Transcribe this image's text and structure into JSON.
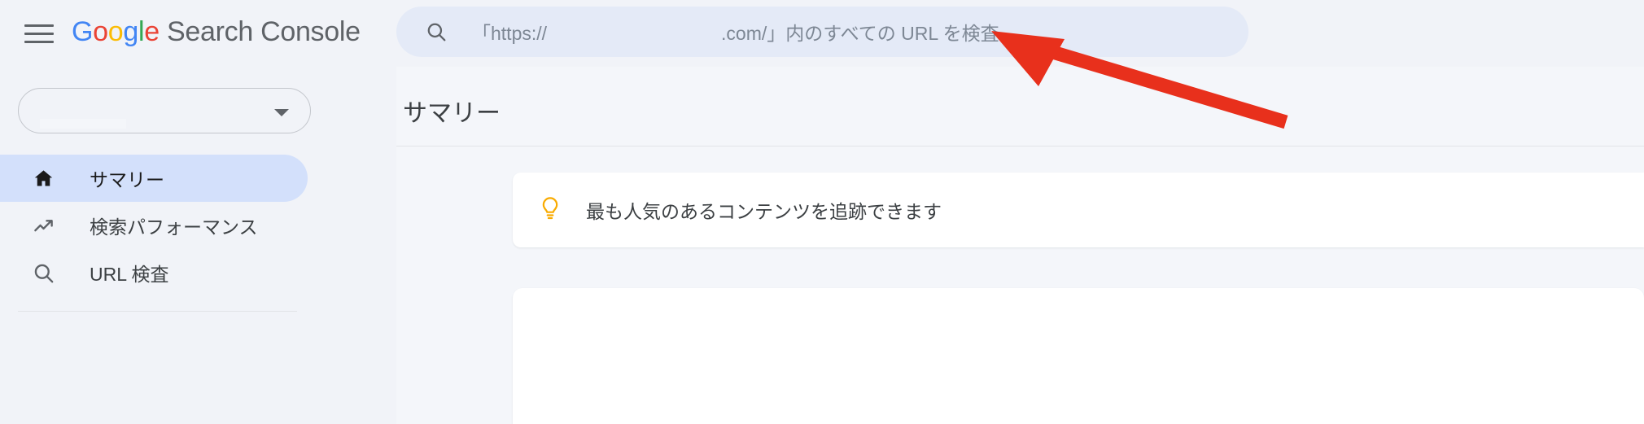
{
  "app": {
    "brand_google": "Google",
    "brand_product": "Search Console",
    "brand_letters": [
      "G",
      "o",
      "o",
      "g",
      "l",
      "e"
    ],
    "menu_icon": "hamburger-menu-icon"
  },
  "search": {
    "icon": "search-icon",
    "placeholder_full": "「https://          .com/」内のすべての URL を検査",
    "placeholder_prefix": "「https://",
    "placeholder_redacted": true,
    "placeholder_suffix": ".com/」内のすべての URL を検査",
    "value": "",
    "background_color": "#e4eaf7"
  },
  "sidebar": {
    "property_selector": {
      "name": "property-selector",
      "value": "",
      "redacted": true,
      "chevron_icon": "chevron-down-icon"
    },
    "items": [
      {
        "id": "summary",
        "label": "サマリー",
        "icon": "home-icon",
        "active": true
      },
      {
        "id": "search-performance",
        "label": "検索パフォーマンス",
        "icon": "trending-up-icon",
        "active": false
      },
      {
        "id": "url-inspection",
        "label": "URL 検査",
        "icon": "search-icon",
        "active": false
      }
    ],
    "active_background": "#d3e0fb"
  },
  "main": {
    "page_title": "サマリー",
    "tip_card": {
      "icon": "lightbulb-icon",
      "icon_color": "#f9ab00",
      "text": "最も人気のあるコンテンツを追跡できます"
    },
    "second_card": {
      "name": "performance-card",
      "content": ""
    }
  },
  "annotation": {
    "type": "arrow",
    "color": "#e8301c",
    "points_to": "search-input",
    "direction": "up-left"
  },
  "colors": {
    "page_background": "#f1f3f8",
    "content_background": "#f4f6fa",
    "card_background": "#ffffff",
    "text_primary": "#3c4043",
    "text_secondary": "#7d8794",
    "accent_blue": "#4285f4",
    "accent_red": "#ea4335",
    "accent_yellow": "#fbbc05",
    "accent_green": "#34a853"
  }
}
